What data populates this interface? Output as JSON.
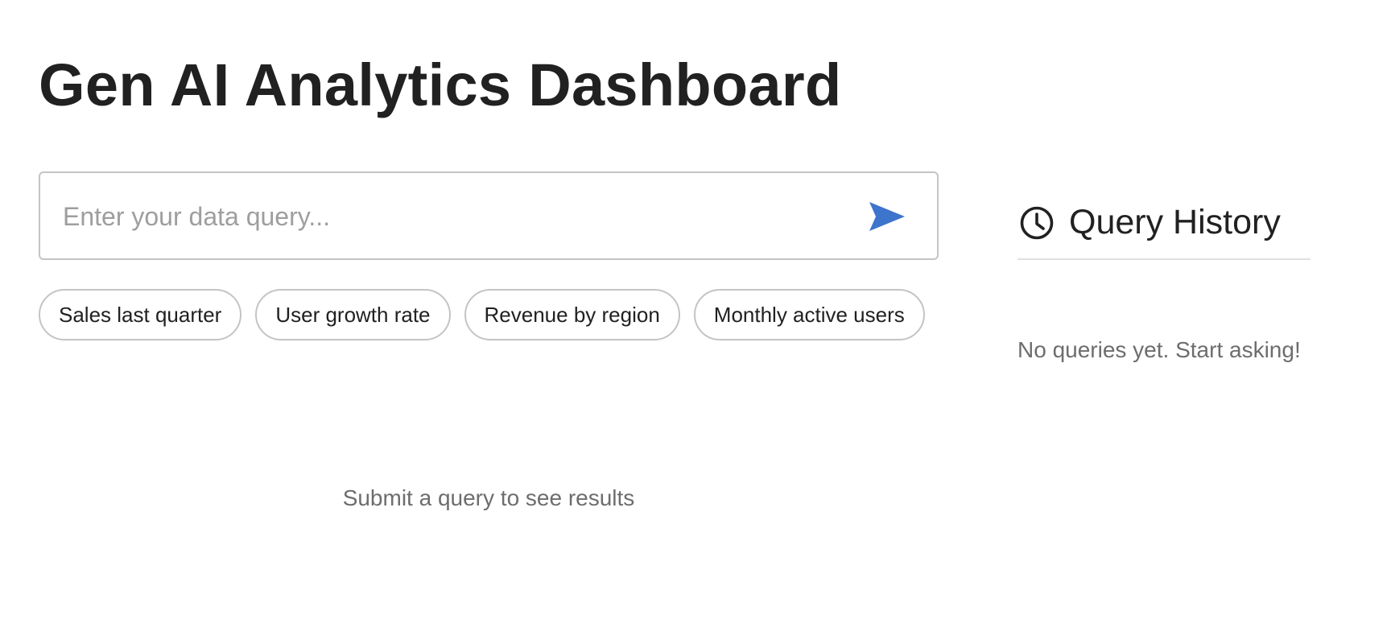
{
  "page": {
    "title": "Gen AI Analytics Dashboard"
  },
  "query": {
    "placeholder": "Enter your data query...",
    "value": "",
    "send_icon": "send-icon"
  },
  "suggestions": [
    {
      "label": "Sales last quarter"
    },
    {
      "label": "User growth rate"
    },
    {
      "label": "Revenue by region"
    },
    {
      "label": "Monthly active users"
    }
  ],
  "results": {
    "empty_message": "Submit a query to see results"
  },
  "history": {
    "icon": "clock-icon",
    "title": "Query History",
    "empty_message": "No queries yet. Start asking!"
  },
  "colors": {
    "accent": "#3d74cc",
    "text": "#212121",
    "muted": "#6d6d6d",
    "border": "#c4c4c4"
  }
}
